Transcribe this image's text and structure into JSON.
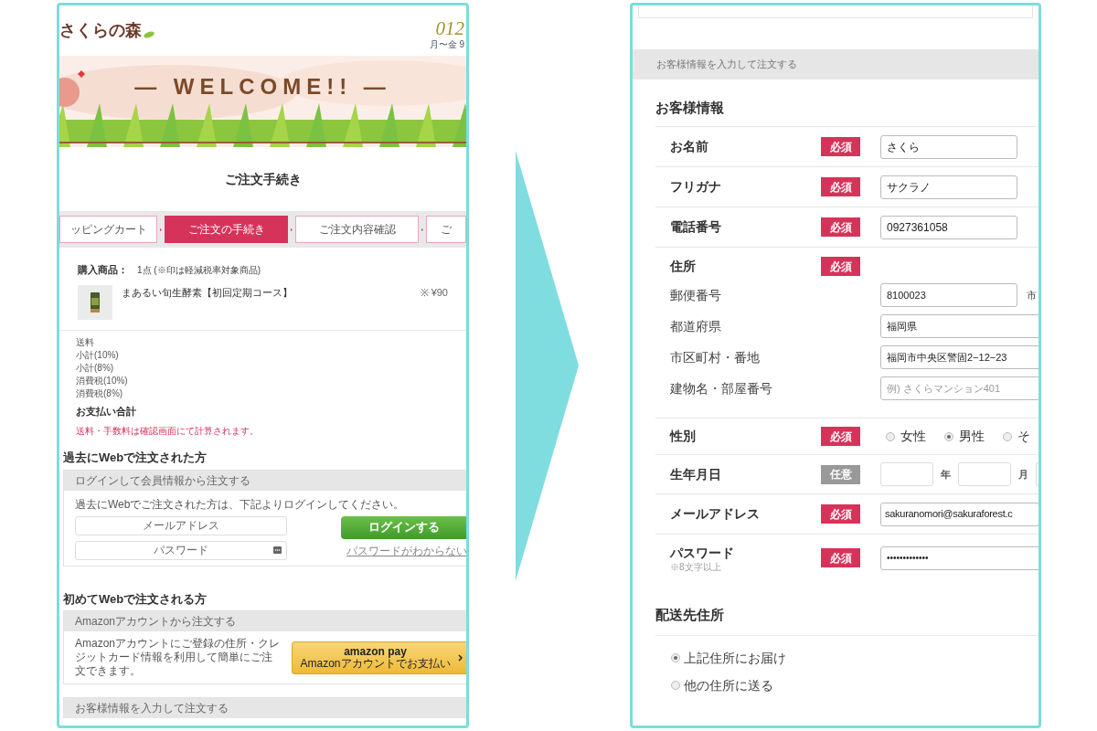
{
  "left_panel": {
    "header": {
      "logo": "さくらの森",
      "phone": "012",
      "hours": "月〜金 9"
    },
    "banner": {
      "kind": "picture",
      "title": "— WELCOME!! —"
    },
    "page_title": "ご注文手続き",
    "steps": [
      {
        "label": "ッピングカート",
        "selected": false
      },
      {
        "label": "ご注文の手続き",
        "selected": true
      },
      {
        "label": "ご注文内容確認",
        "selected": false
      },
      {
        "label": "ご",
        "selected": false
      }
    ],
    "purchase": {
      "label": "購入商品：",
      "count": "1点 (※印は軽減税率対象商品)",
      "items": [
        {
          "name": "まあるい旬生酵素【初回定期コース】",
          "price": "※ ¥90"
        }
      ]
    },
    "summary": [
      "送料",
      "小計(10%)",
      "小計(8%)",
      "消費税(10%)",
      "消費税(8%)"
    ],
    "total_label": "お支払い合計",
    "note": "送料・手数料は確認画面にて計算されます。",
    "returning": {
      "heading": "過去にWebで注文された方",
      "panel_title": "ログインして会員情報から注文する",
      "text": "過去にWebでご注文された方は、下記よりログインしてください。",
      "email_placeholder": "メールアドレス",
      "password_placeholder": "パスワード",
      "login_button": "ログインする",
      "forgot_link": "パスワードがわからない"
    },
    "first_time": {
      "heading": "初めてWebで注文される方",
      "panel_title": "Amazonアカウントから注文する",
      "text": "Amazonアカウントにご登録の住所・クレジットカード情報を利用して簡単にご注文できます。",
      "amazon_logo": "amazon pay",
      "amazon_sub": "Amazonアカウントでお支払い"
    },
    "customer_panel_title": "お客様情報を入力して注文する"
  },
  "right_panel": {
    "section_bar": "お客様情報を入力して注文する",
    "heading": "お客様情報",
    "rows": [
      {
        "kind": "text",
        "label": "お名前",
        "badge": {
          "text": "必須",
          "required": true
        },
        "value": "さくら"
      },
      {
        "kind": "text",
        "label": "フリガナ",
        "badge": {
          "text": "必須",
          "required": true
        },
        "value": "サクラノ"
      },
      {
        "kind": "text",
        "label": "電話番号",
        "badge": {
          "text": "必須",
          "required": true
        },
        "value": "0927361058"
      },
      {
        "kind": "address",
        "label": "住所",
        "badge": {
          "text": "必須",
          "required": true
        },
        "fields": [
          {
            "label": "郵便番号",
            "value": "8100023",
            "suffix": "市"
          },
          {
            "label": "都道府県",
            "value": "福岡県"
          },
          {
            "label": "市区町村・番地",
            "value": "福岡市中央区警固2−12−23"
          },
          {
            "label": "建物名・部屋番号",
            "placeholder": "例) さくらマンション401"
          }
        ]
      },
      {
        "kind": "radio",
        "label": "性別",
        "badge": {
          "text": "必須",
          "required": true
        },
        "options": [
          {
            "label": "女性",
            "selected": false
          },
          {
            "label": "男性",
            "selected": true
          },
          {
            "label": "そ",
            "selected": false
          }
        ]
      },
      {
        "kind": "date",
        "label": "生年月日",
        "badge": {
          "text": "任意",
          "required": false
        },
        "units": [
          "年",
          "月"
        ]
      },
      {
        "kind": "text",
        "label": "メールアドレス",
        "badge": {
          "text": "必須",
          "required": true
        },
        "value": "sakuranomori@sakuraforest.c"
      },
      {
        "kind": "password",
        "label": "パスワード",
        "note": "※8文字以上",
        "badge": {
          "text": "必須",
          "required": true
        },
        "value": "•••••••••••••"
      }
    ],
    "shipping": {
      "heading": "配送先住所",
      "options": [
        {
          "label": "上記住所にお届け",
          "selected": true
        },
        {
          "label": "他の住所に送る",
          "selected": false
        }
      ]
    }
  }
}
